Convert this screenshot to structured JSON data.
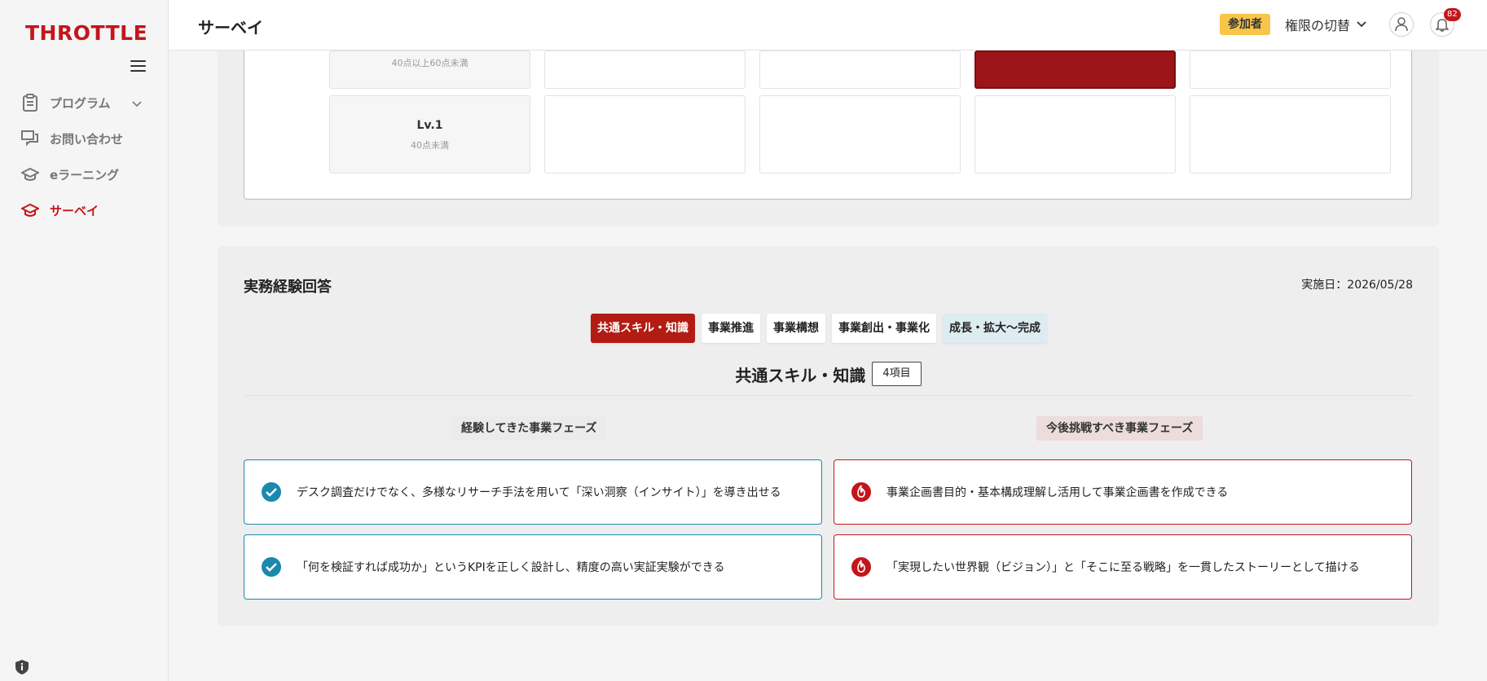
{
  "app": {
    "logo_text": "THROTTLE"
  },
  "sidebar": {
    "items": [
      {
        "label": "プログラム",
        "icon": "clipboard-icon",
        "has_submenu": true
      },
      {
        "label": "お問い合わせ",
        "icon": "chat-icon"
      },
      {
        "label": "eラーニング",
        "icon": "graduation-cap-icon"
      },
      {
        "label": "サーベイ",
        "icon": "graduation-cap-icon",
        "active": true
      }
    ]
  },
  "header": {
    "title": "サーベイ",
    "role_badge": "参加者",
    "role_switch_label": "権限の切替",
    "notification_count": "82"
  },
  "matrix": {
    "rows": [
      {
        "level": "",
        "range": "40点以上60点未満",
        "filled_column": 3
      },
      {
        "level": "Lv.1",
        "range": "40点未満",
        "filled_column": null
      }
    ]
  },
  "experience": {
    "title": "実務経験回答",
    "date_label": "実施日：2026/05/28",
    "tabs": [
      {
        "label": "共通スキル・知識",
        "state": "active"
      },
      {
        "label": "事業推進",
        "state": "normal"
      },
      {
        "label": "事業構想",
        "state": "normal"
      },
      {
        "label": "事業創出・事業化",
        "state": "normal"
      },
      {
        "label": "成長・拡大〜完成",
        "state": "light"
      }
    ],
    "section_title": "共通スキル・知識",
    "item_count": "4項目",
    "left_column_title": "経験してきた事業フェーズ",
    "right_column_title": "今後挑戦すべき事業フェーズ",
    "experienced": [
      "デスク調査だけでなく、多様なリサーチ手法を用いて「深い洞察（インサイト）」を導き出せる",
      "「何を検証すれば成功か」というKPIを正しく設計し、精度の高い実証実験ができる"
    ],
    "challenges": [
      "事業企画書目的・基本構成理解し活用して事業企画書を作成できる",
      "「実現したい世界観（ビジョン）」と「そこに至る戦略」を一貫したストーリーとして描ける"
    ]
  },
  "colors": {
    "brand": "#c3161c",
    "accent_blue": "#1b88ad",
    "badge_yellow": "#f7c54a",
    "matrix_fill": "#9c1519"
  }
}
